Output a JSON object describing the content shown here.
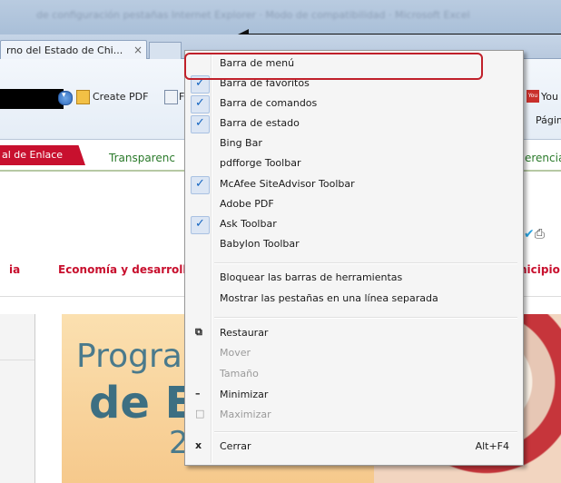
{
  "browser": {
    "tab_title": "rno del Estado de Chi...",
    "tab_close": "×",
    "blurred_title": "de configuración pestañas Internet Explorer · Modo de compatibilidad · Microsoft Excel"
  },
  "command_bar": {
    "create_pdf_label": "Create PDF",
    "partial_f": "F",
    "youtube_label": "You",
    "pagina_label": "Págin"
  },
  "page": {
    "red_tab_label": "al de Enlace",
    "green_tab_left": "Transparenc",
    "green_tab_right": "erencia",
    "nav_left": "ia",
    "nav_economia": "Economía y desarrollo",
    "nav_right": "nicipio",
    "banner_line1": "Program",
    "banner_line2": "de Ed",
    "banner_line3": "2"
  },
  "menu": {
    "items": [
      {
        "label": "Barra de menú",
        "checked": false
      },
      {
        "label": "Barra de favoritos",
        "checked": true
      },
      {
        "label": "Barra de comandos",
        "checked": true
      },
      {
        "label": "Barra de estado",
        "checked": true
      },
      {
        "label": "Bing Bar",
        "checked": false
      },
      {
        "label": "pdfforge Toolbar",
        "checked": false
      },
      {
        "label": "McAfee SiteAdvisor Toolbar",
        "checked": true
      },
      {
        "label": "Adobe PDF",
        "checked": false
      },
      {
        "label": "Ask Toolbar",
        "checked": true
      },
      {
        "label": "Babylon Toolbar",
        "checked": false
      },
      {
        "label": "Bloquear las barras de herramientas"
      },
      {
        "label": "Mostrar las pestañas en una línea separada"
      },
      {
        "label": "Restaurar",
        "enabled": true
      },
      {
        "label": "Mover",
        "enabled": false
      },
      {
        "label": "Tamaño",
        "enabled": false
      },
      {
        "label": "Minimizar",
        "enabled": true
      },
      {
        "label": "Maximizar",
        "enabled": false
      },
      {
        "label": "Cerrar",
        "enabled": true,
        "shortcut": "Alt+F4"
      }
    ],
    "check_glyph": "✓",
    "colors": {
      "highlight_border": "#c0202a",
      "check": "#1565c0"
    }
  }
}
